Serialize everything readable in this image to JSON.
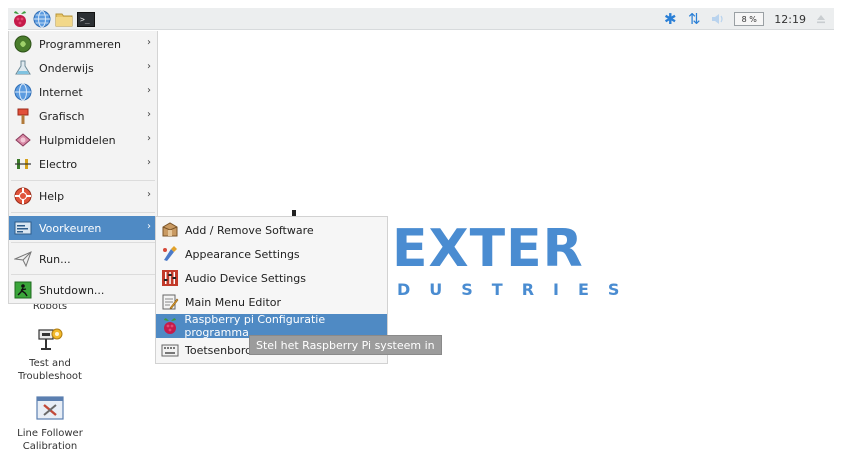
{
  "taskbar": {
    "left_icons": [
      "raspberry-icon",
      "globe-icon",
      "folder-icon",
      "terminal-icon"
    ],
    "terminal_glyph": ">_",
    "tray": {
      "bluetooth_glyph": "✱",
      "network_glyph": "⇅",
      "cpu_label": "8 %",
      "clock": "12:19"
    }
  },
  "desktop": {
    "logo_big": "EXTER",
    "logo_small": "DUSTRIES",
    "icons": [
      {
        "label": "Robots"
      },
      {
        "label_line1": "Test and",
        "label_line2": "Troubleshoot"
      },
      {
        "label_line1": "Line Follower",
        "label_line2": "Calibration"
      }
    ]
  },
  "menu": {
    "items": [
      {
        "label": "Programmeren",
        "icon": "programming-icon",
        "arrow": "›"
      },
      {
        "label": "Onderwijs",
        "icon": "education-icon",
        "arrow": "›"
      },
      {
        "label": "Internet",
        "icon": "globe-icon",
        "arrow": "›"
      },
      {
        "label": "Grafisch",
        "icon": "graphics-icon",
        "arrow": "›"
      },
      {
        "label": "Hulpmiddelen",
        "icon": "accessories-icon",
        "arrow": "›"
      },
      {
        "label": "Electro",
        "icon": "electronics-icon",
        "arrow": "›"
      },
      {
        "label": "Help",
        "icon": "help-icon",
        "arrow": "›"
      },
      {
        "label": "Voorkeuren",
        "icon": "preferences-icon",
        "arrow": "›"
      },
      {
        "label": "Run...",
        "icon": "run-icon"
      },
      {
        "label": "Shutdown...",
        "icon": "shutdown-icon"
      }
    ]
  },
  "submenu": {
    "items": [
      {
        "label": "Add / Remove Software",
        "icon": "package-icon"
      },
      {
        "label": "Appearance Settings",
        "icon": "appearance-icon"
      },
      {
        "label": "Audio Device Settings",
        "icon": "audio-mixer-icon"
      },
      {
        "label": "Main Menu Editor",
        "icon": "menu-editor-icon"
      },
      {
        "label": "Raspberry pi Configuratie programma",
        "icon": "raspberry-icon"
      },
      {
        "label": "Toetsenbord e",
        "icon": "keyboard-icon"
      }
    ]
  },
  "tooltip": {
    "text": "Stel het Raspberry Pi systeem in"
  },
  "colors": {
    "selection": "#4f8ac4",
    "logo": "#4a8cd1",
    "taskbar": "#eceeef"
  }
}
